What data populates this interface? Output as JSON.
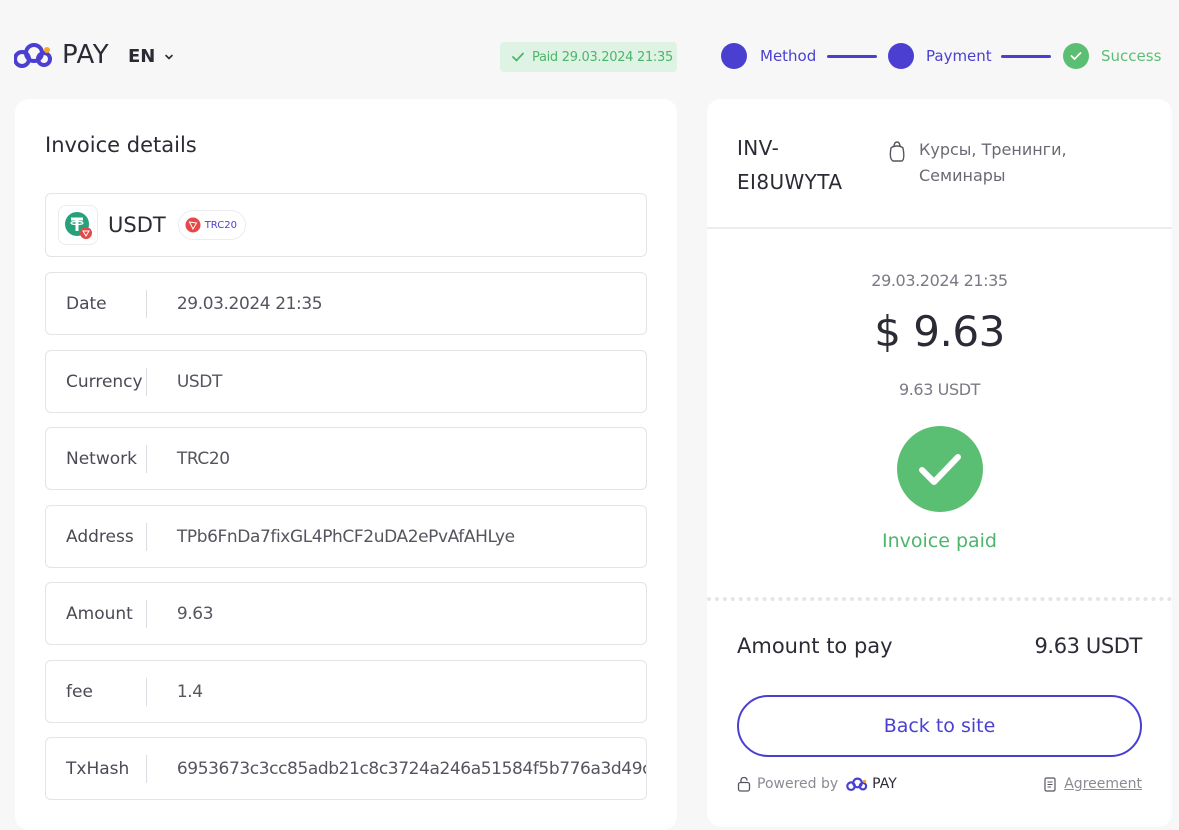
{
  "header": {
    "brand": "PAY",
    "language": "EN",
    "paid_badge": "Paid 29.03.2024 21:35",
    "steps": [
      {
        "label": "Method"
      },
      {
        "label": "Payment"
      },
      {
        "label": "Success"
      }
    ]
  },
  "invoice": {
    "title": "Invoice details",
    "coin": "USDT",
    "network_pill": "TRC20",
    "rows": [
      {
        "label": "Date",
        "value": "29.03.2024 21:35"
      },
      {
        "label": "Currency",
        "value": "USDT"
      },
      {
        "label": "Network",
        "value": "TRC20"
      },
      {
        "label": "Address",
        "value": "TPb6FnDa7fixGL4PhCF2uDA2ePvAfAHLye"
      },
      {
        "label": "Amount",
        "value": "9.63"
      },
      {
        "label": "fee",
        "value": "1.4"
      },
      {
        "label": "TxHash",
        "value": "6953673c3cc85adb21c8c3724a246a51584f5b776a3d49c"
      }
    ]
  },
  "summary": {
    "invoice_id": "INV-EI8UWYTA",
    "category": "Курсы, Тренинги, Семинары",
    "date": "29.03.2024 21:35",
    "amount_usd": "$ 9.63",
    "amount_crypto": "9.63 USDT",
    "status": "Invoice paid",
    "amount_to_pay_label": "Amount to pay",
    "amount_to_pay_value": "9.63 USDT",
    "back_button": "Back to site",
    "powered_by": "Powered by",
    "powered_brand": "PAY",
    "agreement": "Agreement"
  },
  "colors": {
    "accent": "#4a3fd1",
    "success": "#5bbf73",
    "background": "#f7f7f8"
  }
}
